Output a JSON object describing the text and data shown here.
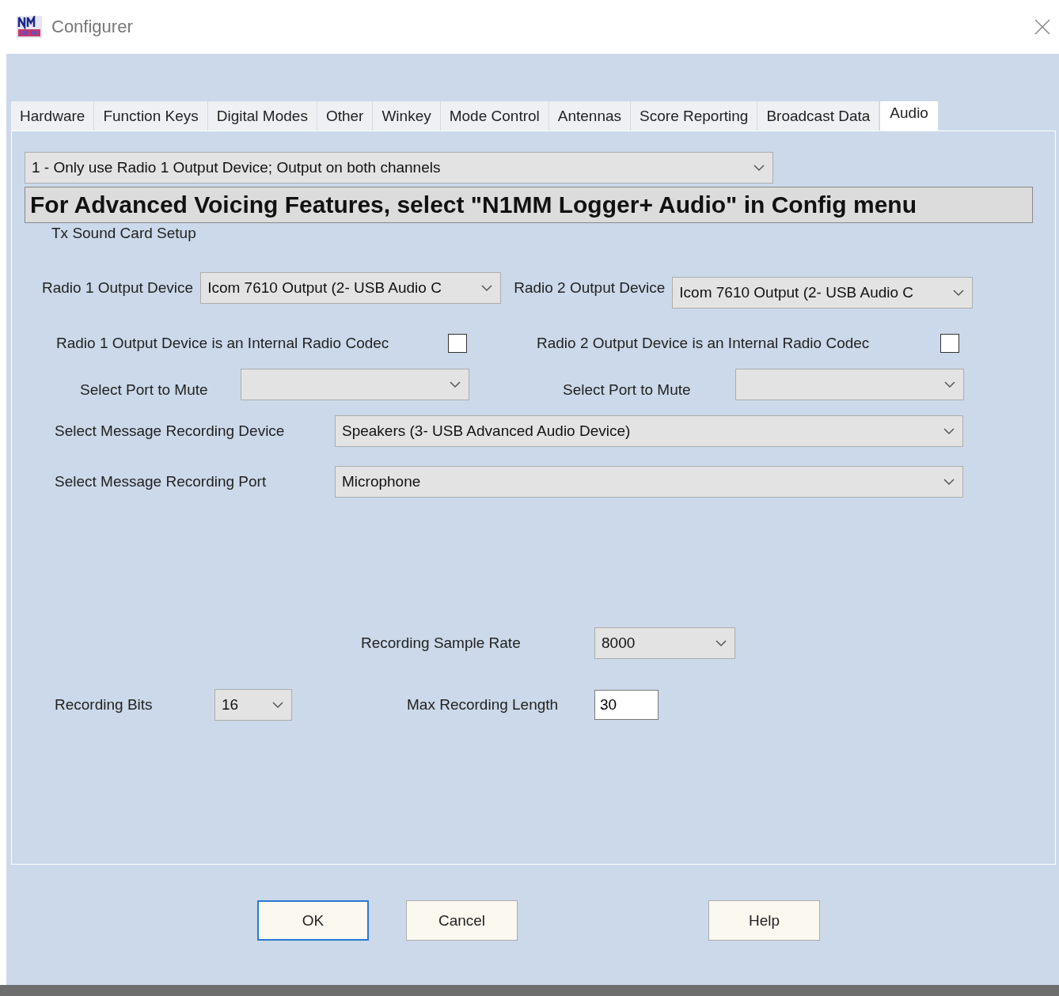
{
  "window": {
    "title": "Configurer"
  },
  "tabs": [
    {
      "label": "Hardware",
      "selected": false
    },
    {
      "label": "Function Keys",
      "selected": false
    },
    {
      "label": "Digital Modes",
      "selected": false
    },
    {
      "label": "Other",
      "selected": false
    },
    {
      "label": "Winkey",
      "selected": false
    },
    {
      "label": "Mode Control",
      "selected": false
    },
    {
      "label": "Antennas",
      "selected": false
    },
    {
      "label": "Score Reporting",
      "selected": false
    },
    {
      "label": "Broadcast Data",
      "selected": false
    },
    {
      "label": "Audio",
      "selected": true
    }
  ],
  "mode_dropdown": {
    "value": "1 - Only use Radio 1 Output Device; Output on both channels"
  },
  "banner": "For Advanced Voicing Features, select \"N1MM Logger+ Audio\" in Config menu",
  "group_label": "Tx Sound Card Setup",
  "output_devices": [
    {
      "label": "Radio 1 Output Device",
      "value": "Icom 7610 Output (2- USB Audio C"
    },
    {
      "label": "Radio 2 Output Device",
      "value": "Icom 7610 Output (2- USB Audio C"
    }
  ],
  "codec_checks": [
    {
      "label": "Radio 1 Output Device is an Internal Radio Codec",
      "checked": false
    },
    {
      "label": "Radio 2 Output Device is an Internal Radio Codec",
      "checked": false
    }
  ],
  "mute_ports": [
    {
      "label": "Select Port to Mute"
    },
    {
      "label": "Select Port to Mute"
    }
  ],
  "recording_device": {
    "label": "Select Message Recording Device",
    "value": "Speakers (3- USB Advanced Audio Device)"
  },
  "recording_port": {
    "label": "Select Message Recording Port",
    "value": "Microphone"
  },
  "sample_rate": {
    "label": "Recording Sample Rate",
    "value": "8000"
  },
  "bits": {
    "label": "Recording Bits",
    "value": "16"
  },
  "max_length": {
    "label": "Max Recording Length",
    "value": "30"
  },
  "buttons": [
    {
      "label": "OK",
      "default": true
    },
    {
      "label": "Cancel",
      "default": false
    },
    {
      "label": "Help",
      "default": false
    }
  ]
}
